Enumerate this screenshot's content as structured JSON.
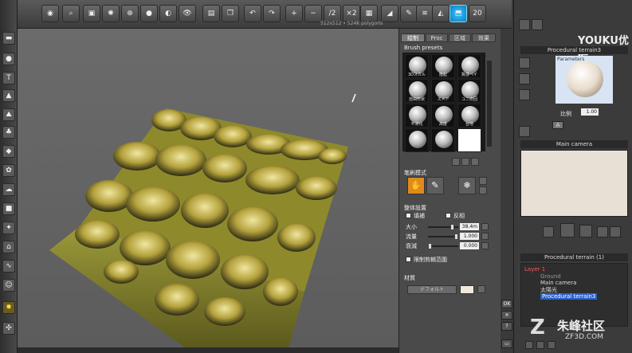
{
  "toolbar": {
    "undo_label": "↶",
    "redo_label": "↷",
    "zoom_in_label": "+",
    "zoom_out_label": "−",
    "div2_label": "/2",
    "x2_label": "×2",
    "x20_label": "20",
    "poly_info": "512x512 • 524K polygons"
  },
  "brush_panel": {
    "tabs": [
      {
        "label": "绘制",
        "active": true
      },
      {
        "label": "Proc",
        "active": false
      },
      {
        "label": "区域",
        "active": false
      },
      {
        "label": "效果",
        "active": false
      }
    ],
    "presets_title": "Brush presets",
    "presets": [
      {
        "label": "3Dスカル"
      },
      {
        "label": "隆起"
      },
      {
        "label": "質感ペイ"
      },
      {
        "label": "自由形状"
      },
      {
        "label": "スメア"
      },
      {
        "label": "ユニ次回"
      },
      {
        "label": "平滑化"
      },
      {
        "label": "高度"
      },
      {
        "label": "台地"
      },
      {
        "label": ""
      },
      {
        "label": ""
      },
      {
        "label": ""
      }
    ],
    "pen_mode_title": "笔刷模式",
    "global_settings_title": "整体設置",
    "color_label": "填補",
    "invert_label": "反相",
    "size_label": "大小",
    "size_value": "38.4m",
    "flow_label": "流量",
    "flow_value": "1.000",
    "falloff_label": "衰減",
    "falloff_value": "0.000",
    "limit_label": "限制剪輯范圍",
    "material_title": "材質",
    "material_default": "デフォルト"
  },
  "ok_buttons": {
    "ok": "OK",
    "close": "✕",
    "help": "?",
    "minimize": "▭"
  },
  "right_panel": {
    "youku": "YOUKU优酷",
    "preview_title": "Procedural terrain3",
    "preview_sub": "Parameters",
    "scale_label": "比例",
    "scale_value": "1.00",
    "a_label": "A",
    "camera_title": "Main camera",
    "tree_title": "Procedural terrain (1)",
    "tree": {
      "layer": "Layer 1",
      "ground": "Ground",
      "main_camera": "Main camera",
      "sun": "太陽光",
      "terrain": "Procedural terrain3"
    }
  },
  "watermark": {
    "cn": "朱峰社区",
    "url": "ZF3D.COM"
  },
  "colors": {
    "accent": "#1a9fe0",
    "selection": "#2c5fc7",
    "layer_red": "#ff5555"
  }
}
